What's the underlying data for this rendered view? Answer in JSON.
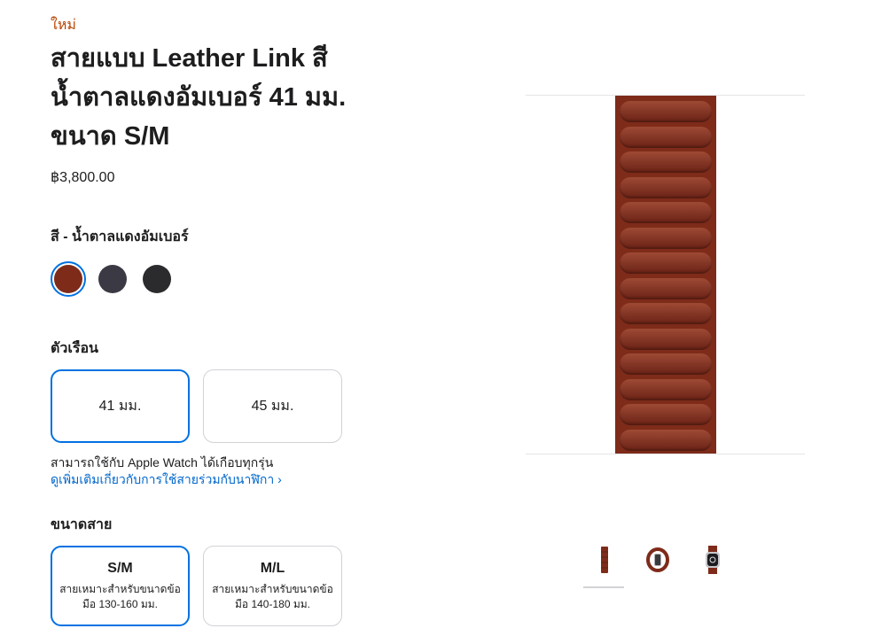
{
  "product": {
    "badge": "ใหม่",
    "title": "สายแบบ Leather Link สีน้ำตาลแดงอัมเบอร์ 41 มม. ขนาด S/M",
    "price": "฿3,800.00"
  },
  "color": {
    "heading": "สี - น้ำตาลแดงอัมเบอร์",
    "swatches": [
      {
        "name": "umber",
        "hex": "#7e2b1a",
        "selected": true
      },
      {
        "name": "midnight",
        "hex": "#3b3a44",
        "selected": false
      },
      {
        "name": "black",
        "hex": "#2b2b2d",
        "selected": false
      }
    ]
  },
  "case": {
    "heading": "ตัวเรือน",
    "options": [
      {
        "label": "41 มม.",
        "selected": true
      },
      {
        "label": "45 มม.",
        "selected": false
      }
    ],
    "compat_text": "สามารถใช้กับ Apple Watch ได้เกือบทุกรุ่น",
    "compat_link": "ดูเพิ่มเติมเกี่ยวกับการใช้สายร่วมกับนาฬิกา ›"
  },
  "band_size": {
    "heading": "ขนาดสาย",
    "options": [
      {
        "label": "S/M",
        "desc": "สายเหมาะสำหรับขนาดข้อมือ 130-160 มม.",
        "selected": true
      },
      {
        "label": "M/L",
        "desc": "สายเหมาะสำหรับขนาดข้อมือ 140-180 มม.",
        "selected": false
      }
    ]
  },
  "colors": {
    "accent": "#0071e3",
    "badge": "#b64400",
    "link": "#0066cc",
    "band": "#7e2b1a"
  },
  "gallery": {
    "thumbnails": [
      "band-straight-icon",
      "band-loop-icon",
      "watch-with-band-icon"
    ],
    "selected_index": 0
  }
}
